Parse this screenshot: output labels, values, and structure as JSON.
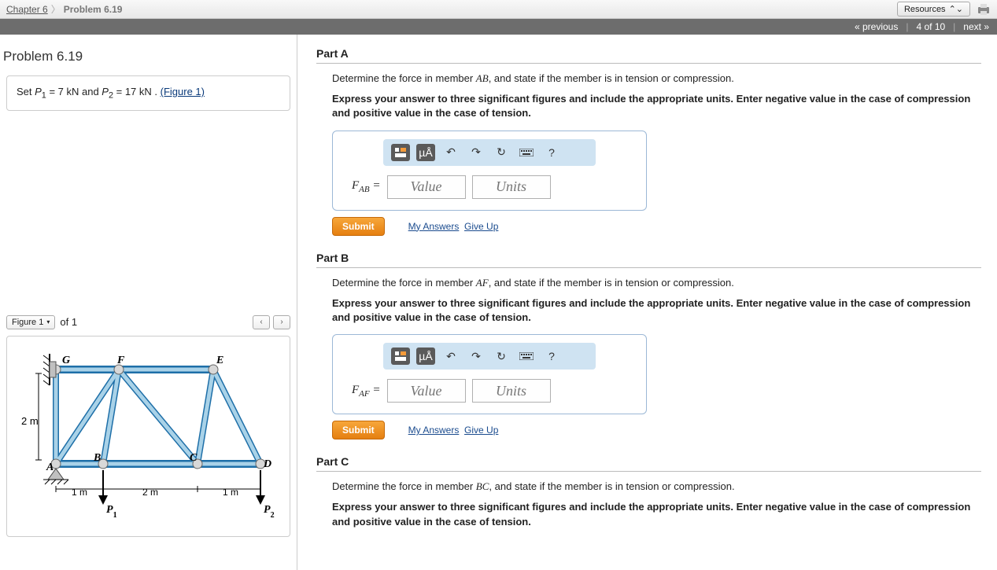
{
  "breadcrumbs": {
    "chapter": "Chapter 6",
    "problem": "Problem 6.19"
  },
  "topRight": {
    "resources": "Resources"
  },
  "navBar": {
    "prev": "« previous",
    "pos": "4 of 10",
    "next": "next »"
  },
  "left": {
    "title": "Problem 6.19",
    "params_pre": "Set ",
    "p1v": "P",
    "p1s": "1",
    "eq1": " = 7  kN and ",
    "p2v": "P",
    "p2s": "2",
    "eq2": " = 17  kN . ",
    "figlink": "(Figure 1)",
    "figSelector": "Figure 1",
    "figOf": "of 1"
  },
  "truss": {
    "height_label": "2 m",
    "dims": {
      "d1": "1 m",
      "d2": "2 m",
      "d3": "1 m"
    },
    "loads": {
      "p1": "P",
      "p1s": "1",
      "p2": "P",
      "p2s": "2"
    },
    "nodes": {
      "A": "A",
      "B": "B",
      "C": "C",
      "D": "D",
      "E": "E",
      "F": "F",
      "G": "G"
    }
  },
  "parts": [
    {
      "title": "Part A",
      "prompt_pre": "Determine the force in member ",
      "member": "AB",
      "prompt_post": ", and state if the member is in tension or compression.",
      "instr": "Express your answer to three significant figures and include the appropriate units. Enter negative value in the case of compression and positive value in the case of tension.",
      "fsym": "F",
      "fsub": "AB",
      "eq": " = ",
      "valPH": "Value",
      "unitPH": "Units",
      "submit": "Submit",
      "myans": "My Answers",
      "giveup": "Give Up"
    },
    {
      "title": "Part B",
      "prompt_pre": "Determine the force in member ",
      "member": "AF",
      "prompt_post": ", and state if the member is in tension or compression.",
      "instr": "Express your answer to three significant figures and include the appropriate units. Enter negative value in the case of compression and positive value in the case of tension.",
      "fsym": "F",
      "fsub": "AF",
      "eq": " = ",
      "valPH": "Value",
      "unitPH": "Units",
      "submit": "Submit",
      "myans": "My Answers",
      "giveup": "Give Up"
    },
    {
      "title": "Part C",
      "prompt_pre": "Determine the force in member ",
      "member": "BC",
      "prompt_post": ", and state if the member is in tension or compression.",
      "instr": "Express your answer to three significant figures and include the appropriate units. Enter negative value in the case of compression and positive value in the case of tension."
    }
  ],
  "toolbar": {
    "mu": "µÅ",
    "q": "?"
  }
}
